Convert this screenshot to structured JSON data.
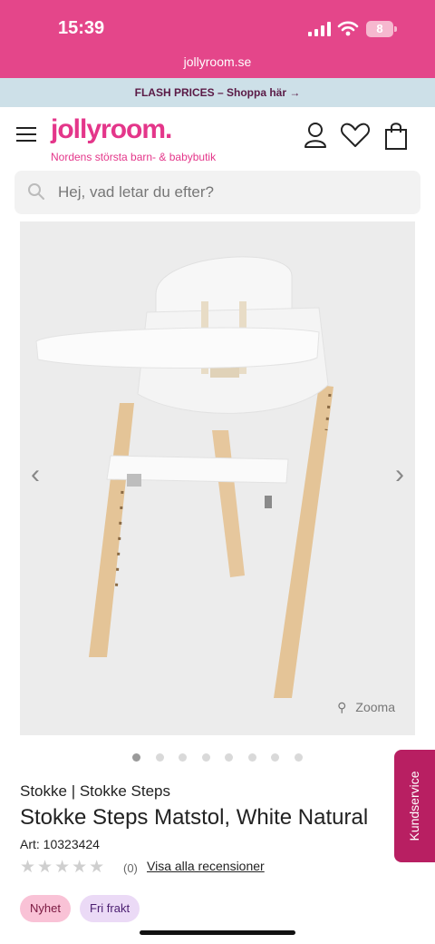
{
  "status_bar": {
    "time": "15:39",
    "battery": "8",
    "url": "jollyroom.se"
  },
  "promo_banner": {
    "text": "FLASH PRICES – Shoppa här →"
  },
  "header": {
    "logo": "jollyroom.",
    "tagline": "Nordens största barn- & babybutik"
  },
  "search": {
    "placeholder": "Hej, vad letar du efter?"
  },
  "gallery": {
    "zoom_label": "Zooma",
    "image_count": 8,
    "active_index": 0
  },
  "product": {
    "brand": "Stokke | Stokke Steps",
    "title": "Stokke Steps Matstol, White Natural",
    "art_label": "Art:",
    "art_number": "10323424",
    "rating_stars": "★★★★★",
    "rating_count": "(0)",
    "reviews_link": "Visa alla recensioner",
    "badges": [
      "Nyhet",
      "Fri frakt"
    ]
  },
  "customer_service": {
    "label": "Kundservice"
  },
  "colors": {
    "brand_pink": "#e4468a",
    "kundservice": "#b81f62"
  }
}
